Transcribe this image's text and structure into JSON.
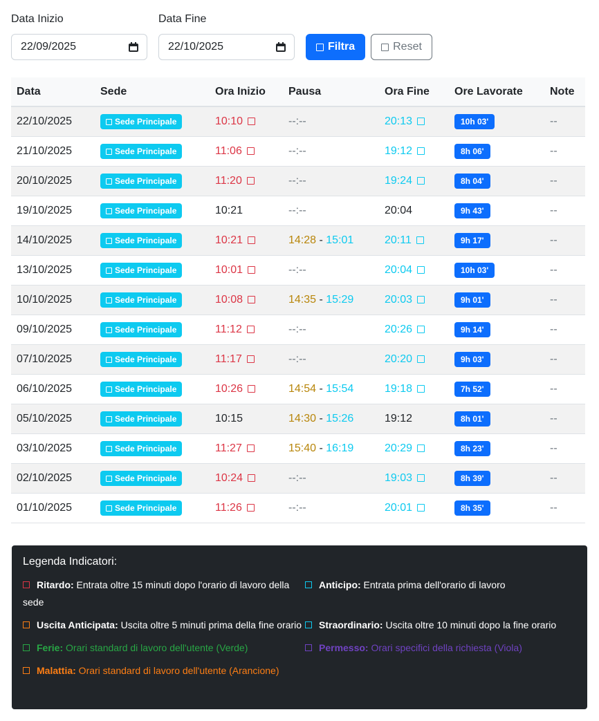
{
  "filters": {
    "start_label": "Data Inizio",
    "start_value": "22/09/2025",
    "end_label": "Data Fine",
    "end_value": "22/10/2025",
    "filter_button": "Filtra",
    "reset_button": "Reset"
  },
  "table": {
    "headers": [
      "Data",
      "Sede",
      "Ora Inizio",
      "Pausa",
      "Ora Fine",
      "Ore Lavorate",
      "Note"
    ],
    "rows": [
      {
        "date": "22/10/2025",
        "sede": "Sede Principale",
        "start": "10:10",
        "start_late": true,
        "pause_start": "",
        "pause_end": "",
        "pause_empty": "--:--",
        "end": "20:13",
        "end_flag": true,
        "hours": "10h 03'",
        "note": "--"
      },
      {
        "date": "21/10/2025",
        "sede": "Sede Principale",
        "start": "11:06",
        "start_late": true,
        "pause_start": "",
        "pause_end": "",
        "pause_empty": "--:--",
        "end": "19:12",
        "end_flag": true,
        "hours": "8h 06'",
        "note": "--"
      },
      {
        "date": "20/10/2025",
        "sede": "Sede Principale",
        "start": "11:20",
        "start_late": true,
        "pause_start": "",
        "pause_end": "",
        "pause_empty": "--:--",
        "end": "19:24",
        "end_flag": true,
        "hours": "8h 04'",
        "note": "--"
      },
      {
        "date": "19/10/2025",
        "sede": "Sede Principale",
        "start": "10:21",
        "start_late": false,
        "pause_start": "",
        "pause_end": "",
        "pause_empty": "--:--",
        "end": "20:04",
        "end_flag": false,
        "hours": "9h 43'",
        "note": "--"
      },
      {
        "date": "14/10/2025",
        "sede": "Sede Principale",
        "start": "10:21",
        "start_late": true,
        "pause_start": "14:28",
        "pause_end": "15:01",
        "pause_empty": "",
        "end": "20:11",
        "end_flag": true,
        "hours": "9h 17'",
        "note": "--"
      },
      {
        "date": "13/10/2025",
        "sede": "Sede Principale",
        "start": "10:01",
        "start_late": true,
        "pause_start": "",
        "pause_end": "",
        "pause_empty": "--:--",
        "end": "20:04",
        "end_flag": true,
        "hours": "10h 03'",
        "note": "--"
      },
      {
        "date": "10/10/2025",
        "sede": "Sede Principale",
        "start": "10:08",
        "start_late": true,
        "pause_start": "14:35",
        "pause_end": "15:29",
        "pause_empty": "",
        "end": "20:03",
        "end_flag": true,
        "hours": "9h 01'",
        "note": "--"
      },
      {
        "date": "09/10/2025",
        "sede": "Sede Principale",
        "start": "11:12",
        "start_late": true,
        "pause_start": "",
        "pause_end": "",
        "pause_empty": "--:--",
        "end": "20:26",
        "end_flag": true,
        "hours": "9h 14'",
        "note": "--"
      },
      {
        "date": "07/10/2025",
        "sede": "Sede Principale",
        "start": "11:17",
        "start_late": true,
        "pause_start": "",
        "pause_end": "",
        "pause_empty": "--:--",
        "end": "20:20",
        "end_flag": true,
        "hours": "9h 03'",
        "note": "--"
      },
      {
        "date": "06/10/2025",
        "sede": "Sede Principale",
        "start": "10:26",
        "start_late": true,
        "pause_start": "14:54",
        "pause_end": "15:54",
        "pause_empty": "",
        "end": "19:18",
        "end_flag": true,
        "hours": "7h 52'",
        "note": "--"
      },
      {
        "date": "05/10/2025",
        "sede": "Sede Principale",
        "start": "10:15",
        "start_late": false,
        "pause_start": "14:30",
        "pause_end": "15:26",
        "pause_empty": "",
        "end": "19:12",
        "end_flag": false,
        "hours": "8h 01'",
        "note": "--"
      },
      {
        "date": "03/10/2025",
        "sede": "Sede Principale",
        "start": "11:27",
        "start_late": true,
        "pause_start": "15:40",
        "pause_end": "16:19",
        "pause_empty": "",
        "end": "20:29",
        "end_flag": true,
        "hours": "8h 23'",
        "note": "--"
      },
      {
        "date": "02/10/2025",
        "sede": "Sede Principale",
        "start": "10:24",
        "start_late": true,
        "pause_start": "",
        "pause_end": "",
        "pause_empty": "--:--",
        "end": "19:03",
        "end_flag": true,
        "hours": "8h 39'",
        "note": "--"
      },
      {
        "date": "01/10/2025",
        "sede": "Sede Principale",
        "start": "11:26",
        "start_late": true,
        "pause_start": "",
        "pause_end": "",
        "pause_empty": "--:--",
        "end": "20:01",
        "end_flag": true,
        "hours": "8h 35'",
        "note": "--"
      }
    ]
  },
  "legend": {
    "title": "Legenda Indicatori:",
    "items": [
      {
        "key": "Ritardo:",
        "text": " Entrata oltre 15 minuti dopo l'orario di lavoro della sede",
        "color": "#dc3545",
        "text_color": "#ffffff",
        "key_color": "#ffffff"
      },
      {
        "key": "Anticipo:",
        "text": " Entrata prima dell'orario di lavoro",
        "color": "#0dcaf0",
        "text_color": "#ffffff",
        "key_color": "#ffffff"
      },
      {
        "key": "Uscita Anticipata:",
        "text": " Uscita oltre 5 minuti prima della fine orario",
        "color": "#fd7e14",
        "text_color": "#ffffff",
        "key_color": "#ffffff"
      },
      {
        "key": "Straordinario:",
        "text": " Uscita oltre 10 minuti dopo la fine orario",
        "color": "#0dcaf0",
        "text_color": "#ffffff",
        "key_color": "#ffffff"
      },
      {
        "key": "Ferie:",
        "text": " Orari standard di lavoro dell'utente (Verde)",
        "color": "#28a745",
        "text_color": "#28a745",
        "key_color": "#28a745"
      },
      {
        "key": "Permesso:",
        "text": " Orari specifici della richiesta (Viola)",
        "color": "#6f42c1",
        "text_color": "#6f42c1",
        "key_color": "#6f42c1"
      },
      {
        "key": "Malattia:",
        "text": " Orari standard di lavoro dell'utente (Arancione)",
        "color": "#fd7e14",
        "text_color": "#fd7e14",
        "key_color": "#fd7e14"
      }
    ]
  },
  "colors": {
    "primary": "#0d6efd",
    "info": "#0dcaf0",
    "danger": "#dc3545",
    "pause": "#b8860b",
    "legend_bg": "#212529"
  }
}
